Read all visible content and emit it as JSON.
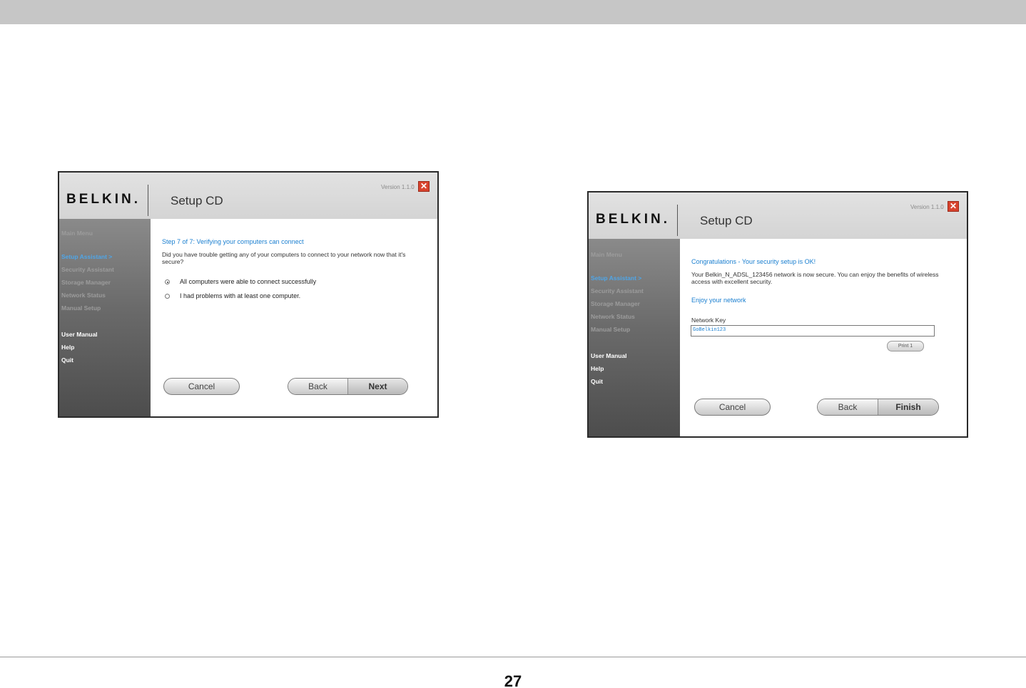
{
  "page": {
    "number": "27"
  },
  "screens": {
    "left": {
      "brand": "BELKIN.",
      "title": "Setup CD",
      "version": "Version 1.1.0",
      "close_glyph": "✕",
      "sidebar": {
        "main_menu": "Main Menu",
        "items": [
          "Setup Assistant  >",
          "Security Assistant",
          "Storage Manager",
          "Network Status",
          "Manual Setup"
        ],
        "links": [
          "User Manual",
          "Help",
          "Quit"
        ]
      },
      "heading": "Step 7 of 7: Verifying your computers can connect",
      "question": "Did you have trouble getting any of your computers to connect to your network now that it's secure?",
      "options": [
        {
          "label": "All computers were able to connect successfully",
          "selected": true
        },
        {
          "label": "I had problems with at least one computer.",
          "selected": false
        }
      ],
      "buttons": {
        "cancel": "Cancel",
        "back": "Back",
        "next": "Next"
      }
    },
    "right": {
      "brand": "BELKIN.",
      "title": "Setup CD",
      "version": "Version 1.1.0",
      "close_glyph": "✕",
      "sidebar": {
        "main_menu": "Main Menu",
        "items": [
          "Setup Assistant  >",
          "Security Assistant",
          "Storage Manager",
          "Network Status",
          "Manual Setup"
        ],
        "links": [
          "User Manual",
          "Help",
          "Quit"
        ]
      },
      "heading": "Congratulations - Your security setup is OK!",
      "message": "Your Belkin_N_ADSL_123456 network is now secure. You can enjoy the benefits of wireless access with excellent security.",
      "subheading": "Enjoy your network",
      "network_key_label": "Network Key",
      "network_key_value": "GoBelkin123",
      "print_label": "Print 1",
      "buttons": {
        "cancel": "Cancel",
        "back": "Back",
        "finish": "Finish"
      }
    }
  },
  "colors": {
    "accent_blue": "#1a7fd0",
    "close_red": "#d8432e"
  }
}
